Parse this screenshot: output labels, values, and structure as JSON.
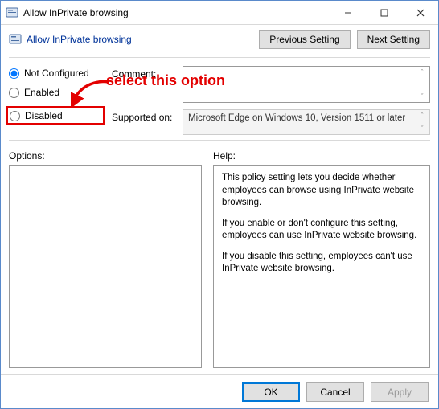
{
  "window": {
    "title": "Allow InPrivate browsing"
  },
  "header": {
    "title": "Allow InPrivate browsing",
    "previous": "Previous Setting",
    "next": "Next Setting"
  },
  "radios": {
    "not_configured": "Not Configured",
    "enabled": "Enabled",
    "disabled": "Disabled",
    "selected": "not_configured"
  },
  "fields": {
    "comment_label": "Comment:",
    "comment_value": "",
    "supported_label": "Supported on:",
    "supported_value": "Microsoft Edge on Windows 10, Version 1511 or later"
  },
  "lower": {
    "options_label": "Options:",
    "help_label": "Help:",
    "help_paragraphs": [
      "This policy setting lets you decide whether employees can browse using InPrivate website browsing.",
      "If you enable or don't configure this setting, employees can use InPrivate website browsing.",
      "If you disable this setting, employees can't use InPrivate website browsing."
    ]
  },
  "footer": {
    "ok": "OK",
    "cancel": "Cancel",
    "apply": "Apply"
  },
  "annotation": {
    "text": "select this option"
  }
}
